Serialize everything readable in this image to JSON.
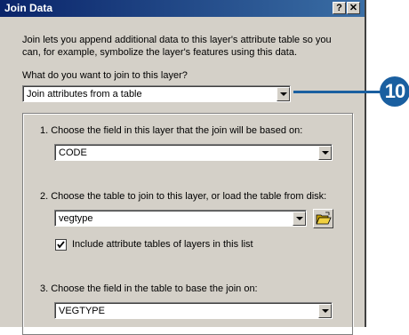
{
  "window": {
    "title": "Join Data",
    "help_button": "?",
    "close_button": "✕"
  },
  "intro_text": "Join lets you append additional data to this layer's attribute table so you can, for example, symbolize the layer's features using this data.",
  "join_question": {
    "label": "What do you want to join to this layer?",
    "value": "Join attributes from a table"
  },
  "step1": {
    "label": "1.  Choose the field in this layer that the join will be based on:",
    "value": "CODE"
  },
  "step2": {
    "label": "2.  Choose the table to join to this layer, or load the table from disk:",
    "value": "vegtype",
    "checkbox_label": "Include attribute tables of layers in this list",
    "checkbox_checked": true
  },
  "step3": {
    "label": "3.  Choose the field in the table to base the join on:",
    "value": "VEGTYPE"
  },
  "callout": {
    "number": "10",
    "color": "#1a5fa0"
  }
}
